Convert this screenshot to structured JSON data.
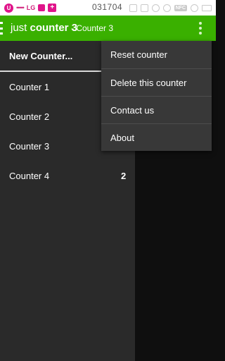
{
  "status_bar": {
    "badge": "U",
    "dots": "•••••",
    "carrier": "LG",
    "plus": "+",
    "time": "031704",
    "nfc": "NFC"
  },
  "action_bar": {
    "title_light": "just",
    "title_bold": "counter 3",
    "subtitle": "- Counter 3"
  },
  "drawer": {
    "new_counter": "New Counter...",
    "counters": [
      {
        "label": "Counter 1",
        "count": ""
      },
      {
        "label": "Counter 2",
        "count": ""
      },
      {
        "label": "Counter 3",
        "count": ""
      },
      {
        "label": "Counter 4",
        "count": "2"
      }
    ]
  },
  "menu": {
    "items": [
      "Reset counter",
      "Delete this counter",
      "Contact us",
      "About"
    ]
  },
  "colors": {
    "accent": "#3ab000",
    "drawer_bg": "#2a2a2a",
    "menu_bg": "#383838",
    "content_bg": "#0f0f0f"
  }
}
